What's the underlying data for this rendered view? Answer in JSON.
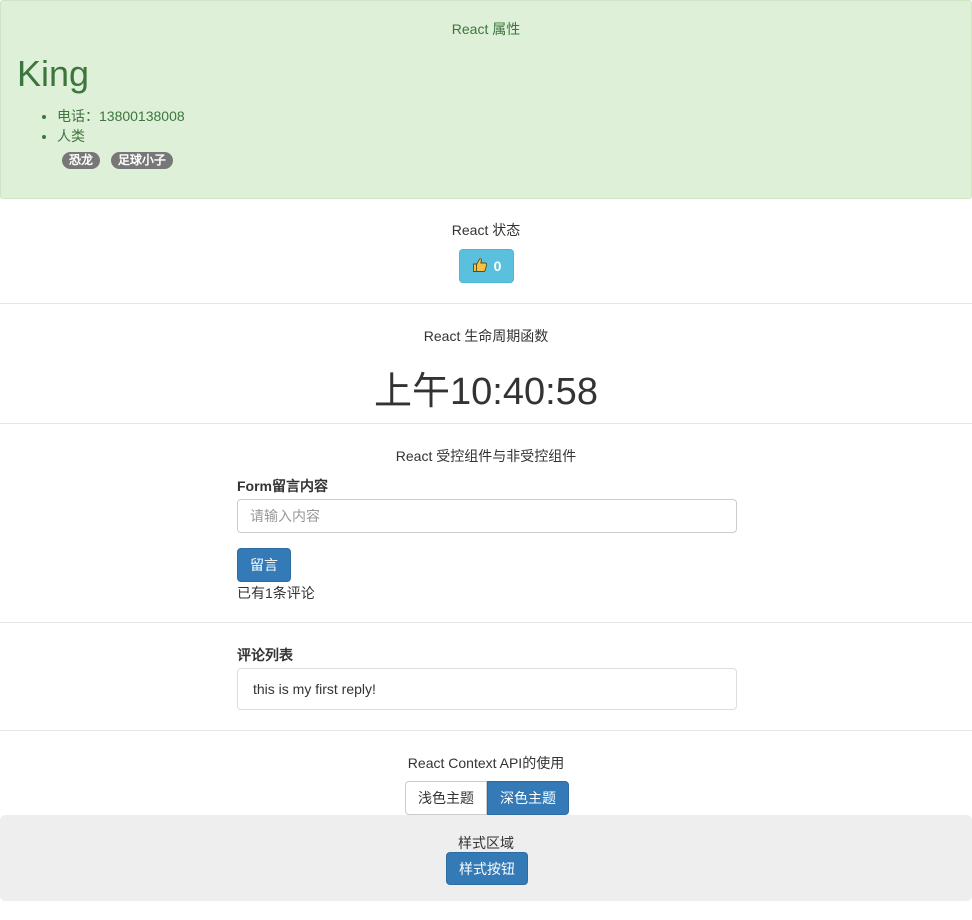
{
  "props": {
    "title": "React 属性",
    "name": "King",
    "details": [
      "电话：13800138008",
      "人类"
    ],
    "tags": [
      "恐龙",
      "足球小子"
    ]
  },
  "state": {
    "title": "React 状态",
    "like_icon": "thumbs-up-icon",
    "like_count": "0"
  },
  "lifecycle": {
    "title": "React 生命周期函数",
    "clock": "上午10:40:58"
  },
  "form": {
    "title": "React 受控组件与非受控组件",
    "label": "Form留言内容",
    "input_value": "",
    "placeholder": "请输入内容",
    "submit_label": "留言",
    "count_text": "已有1条评论"
  },
  "comments": {
    "label": "评论列表",
    "items": [
      "this is my first reply!"
    ]
  },
  "context": {
    "title": "React Context API的使用",
    "light_label": "浅色主题",
    "dark_label": "深色主题"
  },
  "style_area": {
    "title": "样式区域",
    "button_label": "样式按钮"
  },
  "colors": {
    "success_bg": "#dff0d8",
    "success_text": "#3c763d",
    "info": "#5bc0de",
    "primary": "#337ab7",
    "badge": "#777777"
  }
}
